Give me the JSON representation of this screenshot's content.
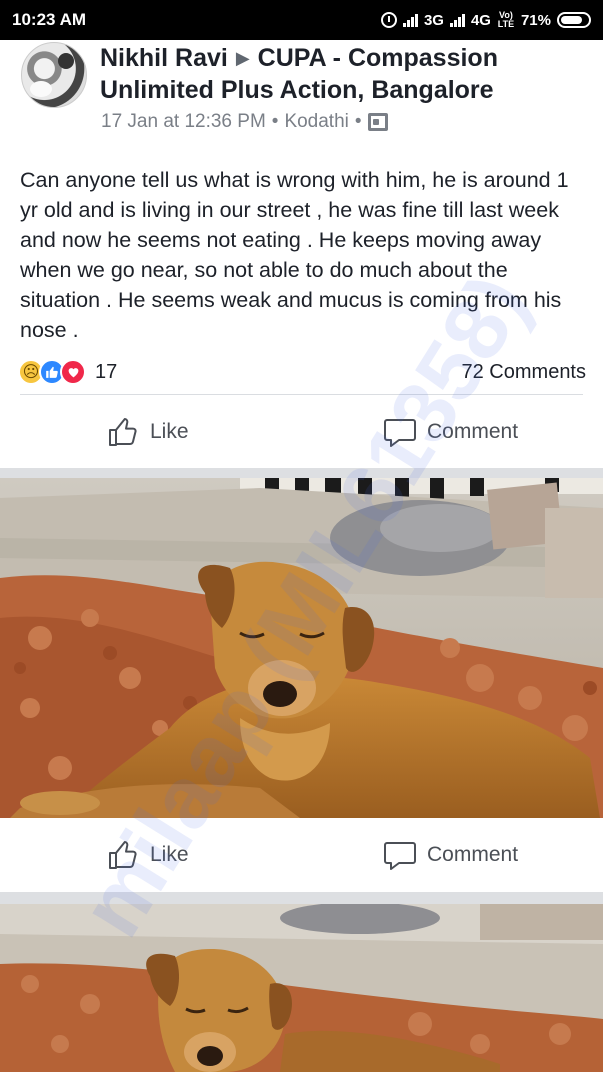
{
  "status_bar": {
    "time": "10:23 AM",
    "network_1": "3G",
    "network_2": "4G",
    "volte": "Vo) LTE",
    "battery": "71%"
  },
  "post": {
    "author": "Nikhil Ravi",
    "group": "CUPA - Compassion Unlimited Plus Action, Bangalore",
    "date": "17 Jan at 12:36 PM",
    "location": "Kodathi",
    "text": "Can anyone tell us what is wrong with him, he is around 1 yr old and is living in our street , he was fine till last week and now he seems not eating . He keeps moving away when we go near, so not able to do much about the situation . He seems weak and mucus is coming from his nose .",
    "reaction_count": "17",
    "comments_count": "72 Comments",
    "like_label": "Like",
    "comment_label": "Comment"
  },
  "photo1_actions": {
    "like_label": "Like",
    "comment_label": "Comment"
  },
  "watermark": "milaap (MIL61358)",
  "colors": {
    "text": "#1d2129",
    "meta": "#7a7f87",
    "action": "#4b4f56",
    "reaction_like": "#2d88ff",
    "reaction_love": "#f0284a"
  }
}
